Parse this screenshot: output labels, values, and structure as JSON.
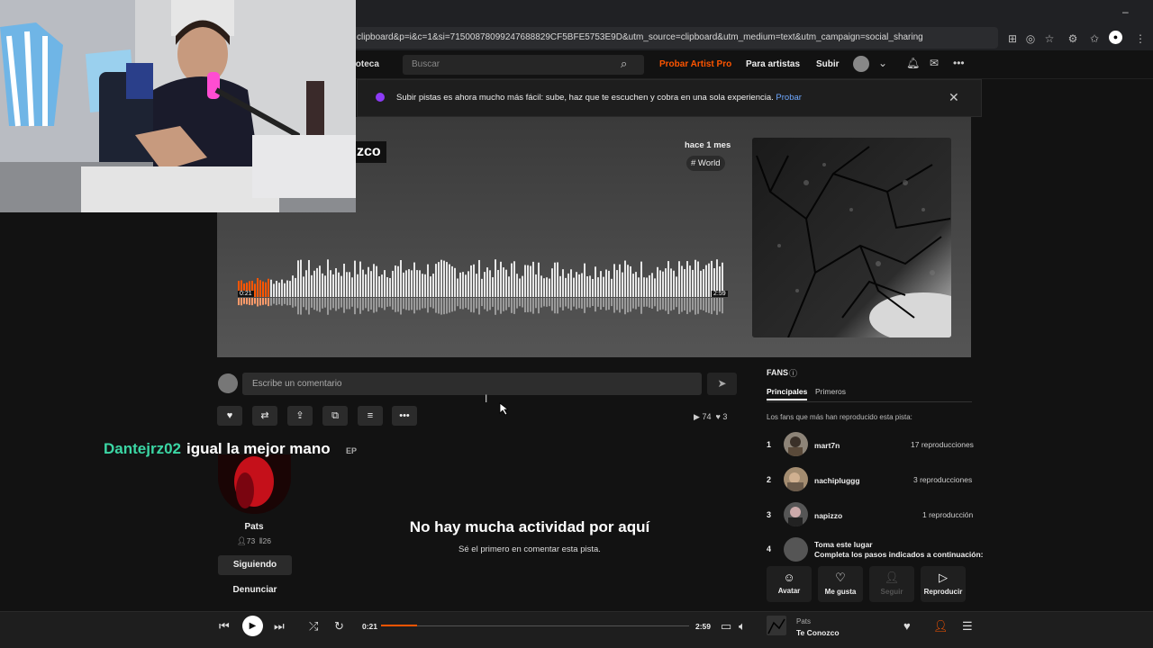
{
  "browser": {
    "url": "clipboard&p=i&c=1&si=71500878099247688829CF5BFE5753E9D&utm_source=clipboard&utm_medium=text&utm_campaign=social_sharing"
  },
  "header": {
    "library": "ioteca",
    "search_placeholder": "Buscar",
    "try_artist_pro": "Probar Artist Pro",
    "for_artists": "Para artistas",
    "upload": "Subir"
  },
  "banner": {
    "text": "Subir pistas es ahora mucho más fácil: sube, haz que te escuchen y cobra en una sola experiencia.",
    "link": "Probar"
  },
  "track": {
    "title_fragment": "zco",
    "posted": "hace 1 mes",
    "genre": "# World",
    "elapsed": "0:21",
    "duration": "2:59",
    "progress": 0.117
  },
  "comment": {
    "placeholder": "Escribe un comentario"
  },
  "stats": {
    "plays": "74",
    "likes": "3"
  },
  "chat": {
    "user": "Dantejrz02",
    "message": "igual la mejor mano",
    "behind_text": "EP"
  },
  "artist": {
    "name": "Pats",
    "followers": "73",
    "tracks": "26",
    "follow_label": "Siguiendo",
    "report_label": "Denunciar"
  },
  "activity": {
    "title": "No hay mucha actividad por aquí",
    "subtitle": "Sé el primero en comentar esta pista."
  },
  "fans": {
    "title": "FANS",
    "tabs": [
      "Principales",
      "Primeros"
    ],
    "description": "Los fans que más han reproducido esta pista:",
    "list": [
      {
        "rank": "1",
        "name": "mart7n",
        "plays": "17 reproducciones"
      },
      {
        "rank": "2",
        "name": "nachipluggg",
        "plays": "3 reproducciones"
      },
      {
        "rank": "3",
        "name": "napizzo",
        "plays": "1 reproducción"
      },
      {
        "rank": "4",
        "name": "Toma este lugar",
        "plays": "Completa los pasos indicados a continuación:"
      }
    ],
    "actions": [
      "Avatar",
      "Me gusta",
      "Seguir",
      "Reproducir"
    ]
  },
  "player": {
    "elapsed": "0:21",
    "duration": "2:59",
    "artist": "Pats",
    "title": "Te Conozco"
  },
  "colors": {
    "accent": "#ff5500",
    "chat_user": "#3bd6a4",
    "banner_dot": "#8d3bf6"
  }
}
